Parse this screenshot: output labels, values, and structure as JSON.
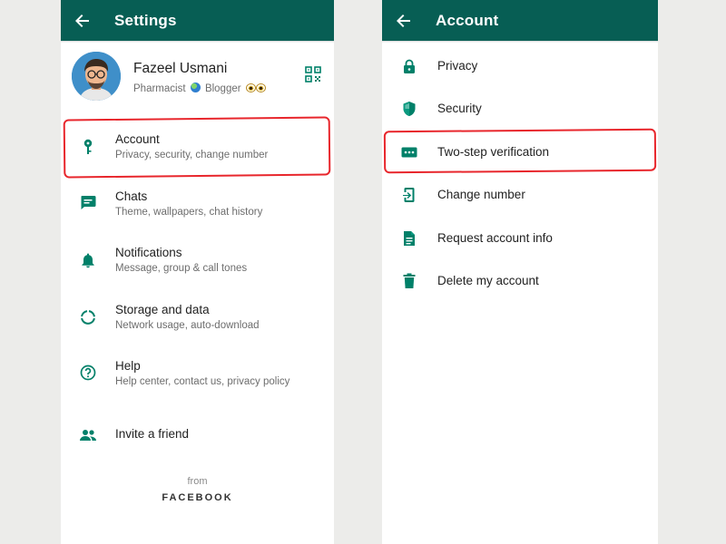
{
  "settings": {
    "title": "Settings",
    "profile": {
      "name": "Fazeel Usmani",
      "about_prefix": "Pharmacist",
      "about_middle": "Blogger"
    },
    "items": [
      {
        "label": "Account",
        "sub": "Privacy, security, change number",
        "icon": "key-icon"
      },
      {
        "label": "Chats",
        "sub": "Theme, wallpapers, chat history",
        "icon": "chat-icon"
      },
      {
        "label": "Notifications",
        "sub": "Message, group & call tones",
        "icon": "bell-icon"
      },
      {
        "label": "Storage and data",
        "sub": "Network usage, auto-download",
        "icon": "data-usage-icon"
      },
      {
        "label": "Help",
        "sub": "Help center, contact us, privacy policy",
        "icon": "help-icon"
      },
      {
        "label": "Invite a friend",
        "icon": "people-icon"
      }
    ],
    "footer": {
      "from": "from",
      "brand": "FACEBOOK"
    }
  },
  "account": {
    "title": "Account",
    "items": [
      {
        "label": "Privacy",
        "icon": "lock-icon"
      },
      {
        "label": "Security",
        "icon": "shield-icon"
      },
      {
        "label": "Two-step verification",
        "icon": "dots-icon"
      },
      {
        "label": "Change number",
        "icon": "change-number-icon"
      },
      {
        "label": "Request account info",
        "icon": "document-icon"
      },
      {
        "label": "Delete my account",
        "icon": "trash-icon"
      }
    ]
  },
  "colors": {
    "appbar": "#075e54",
    "icon_teal": "#008069",
    "highlight_red": "#e8262c",
    "background": "#ececea"
  }
}
